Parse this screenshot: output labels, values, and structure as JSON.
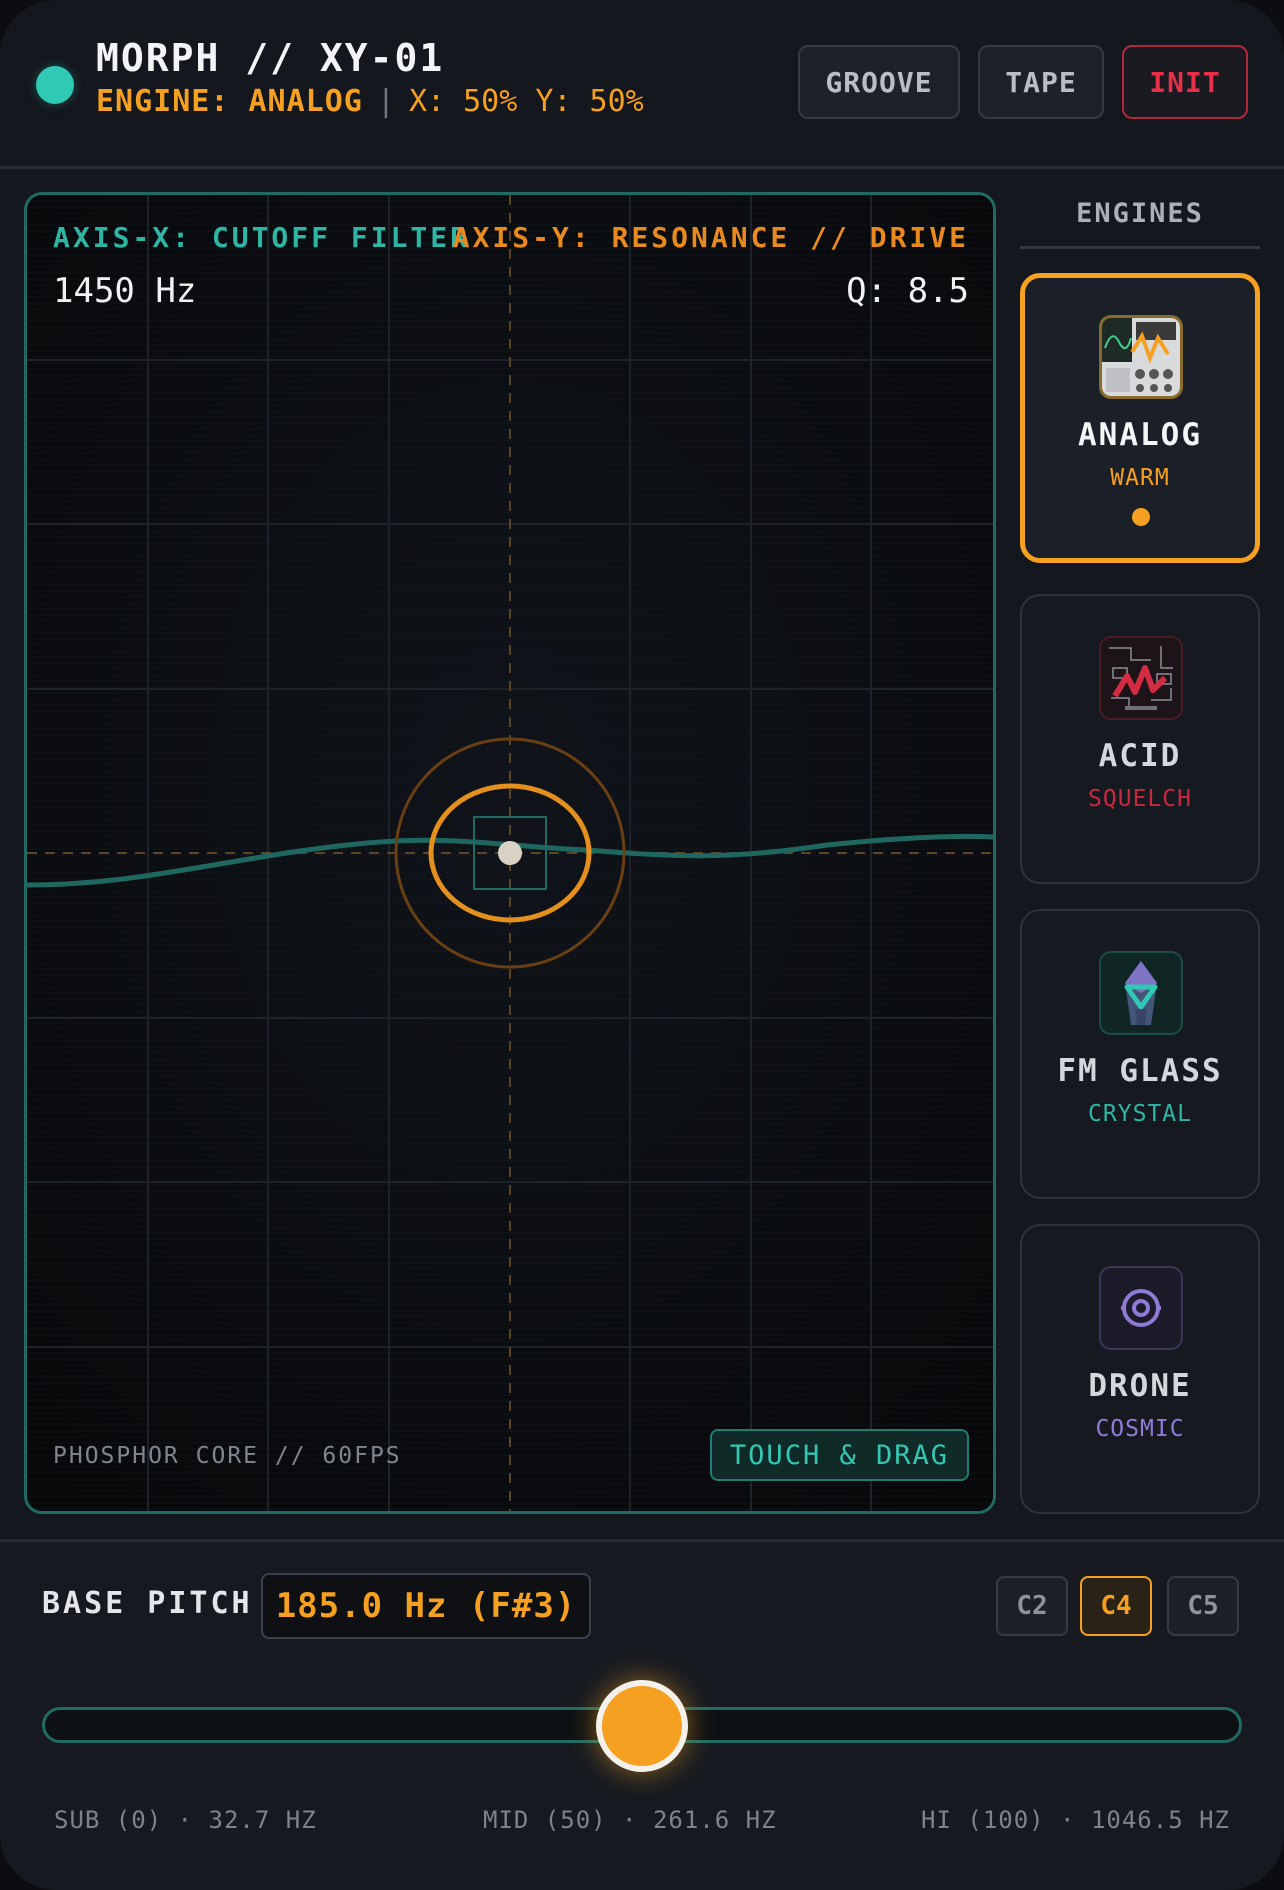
{
  "header": {
    "title": "MORPH // XY-01",
    "engine_status": "ENGINE: ANALOG",
    "separator": "|",
    "xy_readout": "X: 50% Y: 50%",
    "buttons": {
      "groove": "GROOVE",
      "tape": "TAPE",
      "init": "INIT"
    }
  },
  "pad": {
    "axis_x_label": "AXIS-X: CUTOFF FILTER",
    "axis_y_label": "AXIS-Y: RESONANCE // DRIVE",
    "cutoff_readout": "1450 Hz",
    "q_readout": "Q: 8.5",
    "footer_label": "PHOSPHOR CORE // 60FPS",
    "touch_badge": "TOUCH & DRAG",
    "cursor_x_percent": 50,
    "cursor_y_percent": 50
  },
  "engines": {
    "heading": "ENGINES",
    "items": [
      {
        "name": "ANALOG",
        "sub": "WARM",
        "icon": "analog-synth-icon",
        "color": "#f5a020",
        "active": true
      },
      {
        "name": "ACID",
        "sub": "SQUELCH",
        "icon": "acid-circuit-icon",
        "color": "#c8283e",
        "active": false
      },
      {
        "name": "FM GLASS",
        "sub": "CRYSTAL",
        "icon": "crystal-icon",
        "color": "#2fb5a3",
        "active": false
      },
      {
        "name": "DRONE",
        "sub": "COSMIC",
        "icon": "target-icon",
        "color": "#8f7ad6",
        "active": false
      }
    ]
  },
  "pitch": {
    "label": "BASE PITCH",
    "value": "185.0 Hz (F#3)",
    "octaves": [
      "C2",
      "C4",
      "C5"
    ],
    "active_octave": "C4",
    "slider_value": 50,
    "ticks": {
      "low": "SUB (0) · 32.7 HZ",
      "mid": "MID (50) · 261.6 HZ",
      "high": "HI (100) · 1046.5 HZ"
    }
  },
  "colors": {
    "accent": "#f5a020",
    "teal": "#2fb5a3",
    "danger": "#e8304a"
  }
}
